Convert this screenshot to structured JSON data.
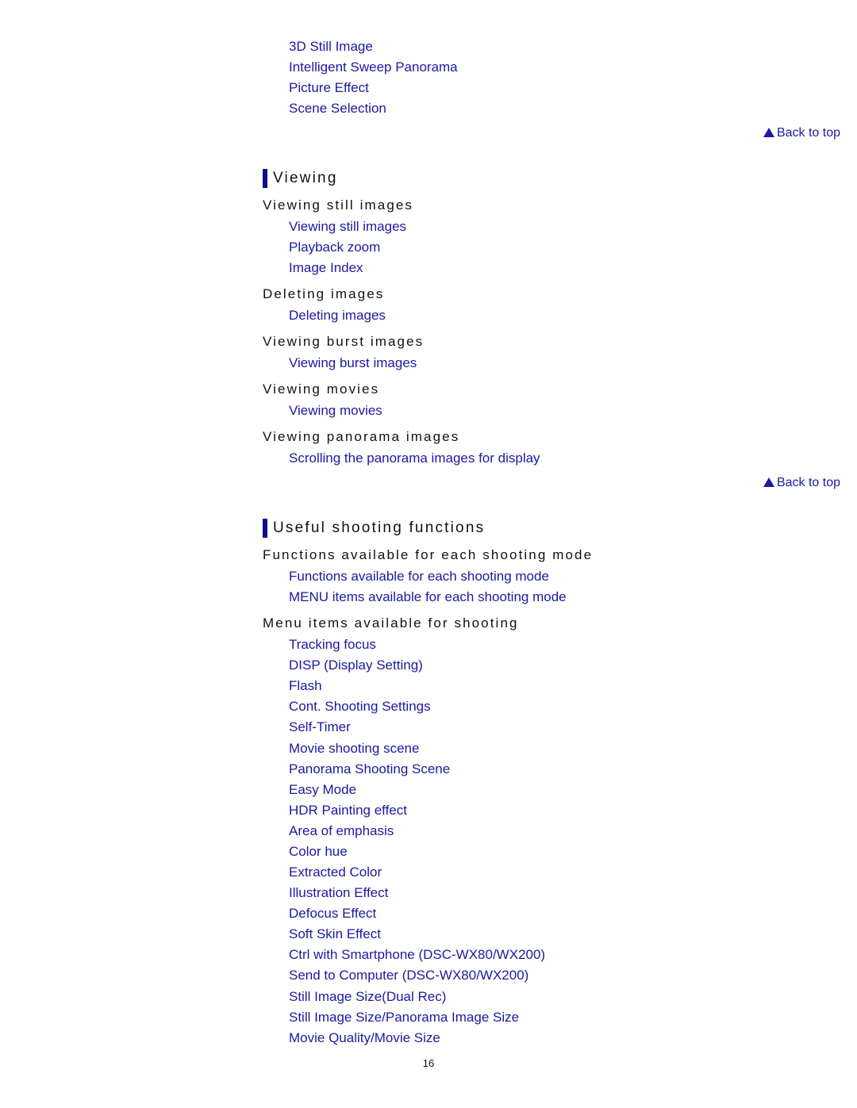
{
  "top_links": [
    "3D Still Image",
    "Intelligent Sweep Panorama",
    "Picture Effect",
    "Scene Selection"
  ],
  "back_to_top": "Back to top",
  "sections": {
    "viewing": {
      "title": "Viewing",
      "groups": [
        {
          "heading": "Viewing still images",
          "links": [
            "Viewing still images",
            "Playback zoom",
            "Image Index"
          ]
        },
        {
          "heading": "Deleting images",
          "links": [
            "Deleting images"
          ]
        },
        {
          "heading": "Viewing burst images",
          "links": [
            "Viewing burst images"
          ]
        },
        {
          "heading": "Viewing movies",
          "links": [
            "Viewing movies"
          ]
        },
        {
          "heading": "Viewing panorama images",
          "links": [
            "Scrolling the panorama images for display"
          ]
        }
      ]
    },
    "useful": {
      "title": "Useful shooting functions",
      "groups": [
        {
          "heading": "Functions available for each shooting mode",
          "links": [
            "Functions available for each shooting mode",
            "MENU items available for each shooting mode"
          ]
        },
        {
          "heading": "Menu items available for shooting",
          "links": [
            "Tracking focus",
            "DISP (Display Setting)",
            "Flash",
            "Cont. Shooting Settings",
            "Self-Timer",
            "Movie shooting scene",
            "Panorama Shooting Scene",
            "Easy Mode",
            "HDR Painting effect",
            "Area of emphasis",
            "Color hue",
            "Extracted Color",
            "Illustration Effect",
            "Defocus Effect",
            "Soft Skin Effect",
            "Ctrl with Smartphone (DSC-WX80/WX200)",
            "Send to Computer (DSC-WX80/WX200)",
            "Still Image Size(Dual Rec)",
            "Still Image Size/Panorama Image Size",
            "Movie Quality/Movie Size"
          ]
        }
      ]
    }
  },
  "page_number": "16",
  "colors": {
    "link": "#1a1aa6",
    "section_bar": "#0a0a8c",
    "text": "#111111"
  }
}
